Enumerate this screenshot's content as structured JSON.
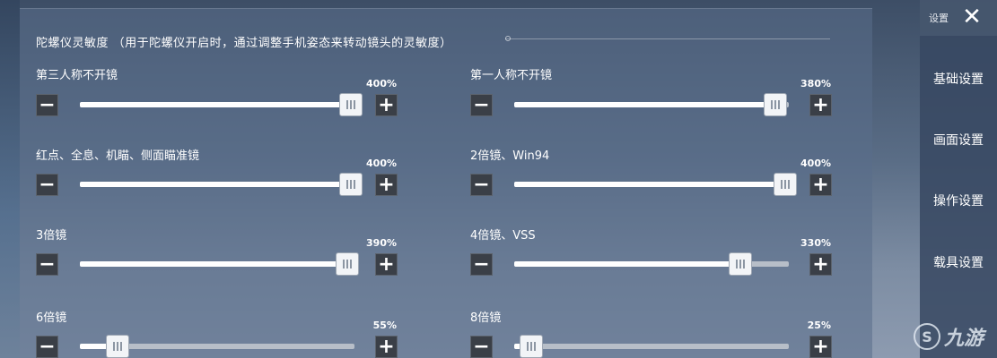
{
  "section": {
    "title": "陀螺仪灵敏度 （用于陀螺仪开启时，通过调整手机姿态来转动镜头的灵敏度）"
  },
  "sliders": [
    {
      "label": "第三人称不开镜",
      "value_text": "400%",
      "fraction": 1.0
    },
    {
      "label": "第一人称不开镜",
      "value_text": "380%",
      "fraction": 0.95
    },
    {
      "label": "红点、全息、机瞄、侧面瞄准镜",
      "value_text": "400%",
      "fraction": 1.0
    },
    {
      "label": "2倍镜、Win94",
      "value_text": "400%",
      "fraction": 1.0
    },
    {
      "label": "3倍镜",
      "value_text": "390%",
      "fraction": 0.975
    },
    {
      "label": "4倍镜、VSS",
      "value_text": "330%",
      "fraction": 0.825
    },
    {
      "label": "6倍镜",
      "value_text": "55%",
      "fraction": 0.1375
    },
    {
      "label": "8倍镜",
      "value_text": "25%",
      "fraction": 0.0625
    }
  ],
  "controls": {
    "minus": "−",
    "plus": "+"
  },
  "sidebar": {
    "header": "设置",
    "close": "✕",
    "items": [
      {
        "label": "基础设置"
      },
      {
        "label": "画面设置"
      },
      {
        "label": "操作设置"
      },
      {
        "label": "载具设置"
      }
    ]
  },
  "watermark": {
    "logo": "S",
    "text": "九游"
  },
  "colors": {
    "panel": "#5a6e8a",
    "button": "#3a3f47",
    "track_fill": "#ffffff",
    "track_empty": "#b7bec8"
  }
}
